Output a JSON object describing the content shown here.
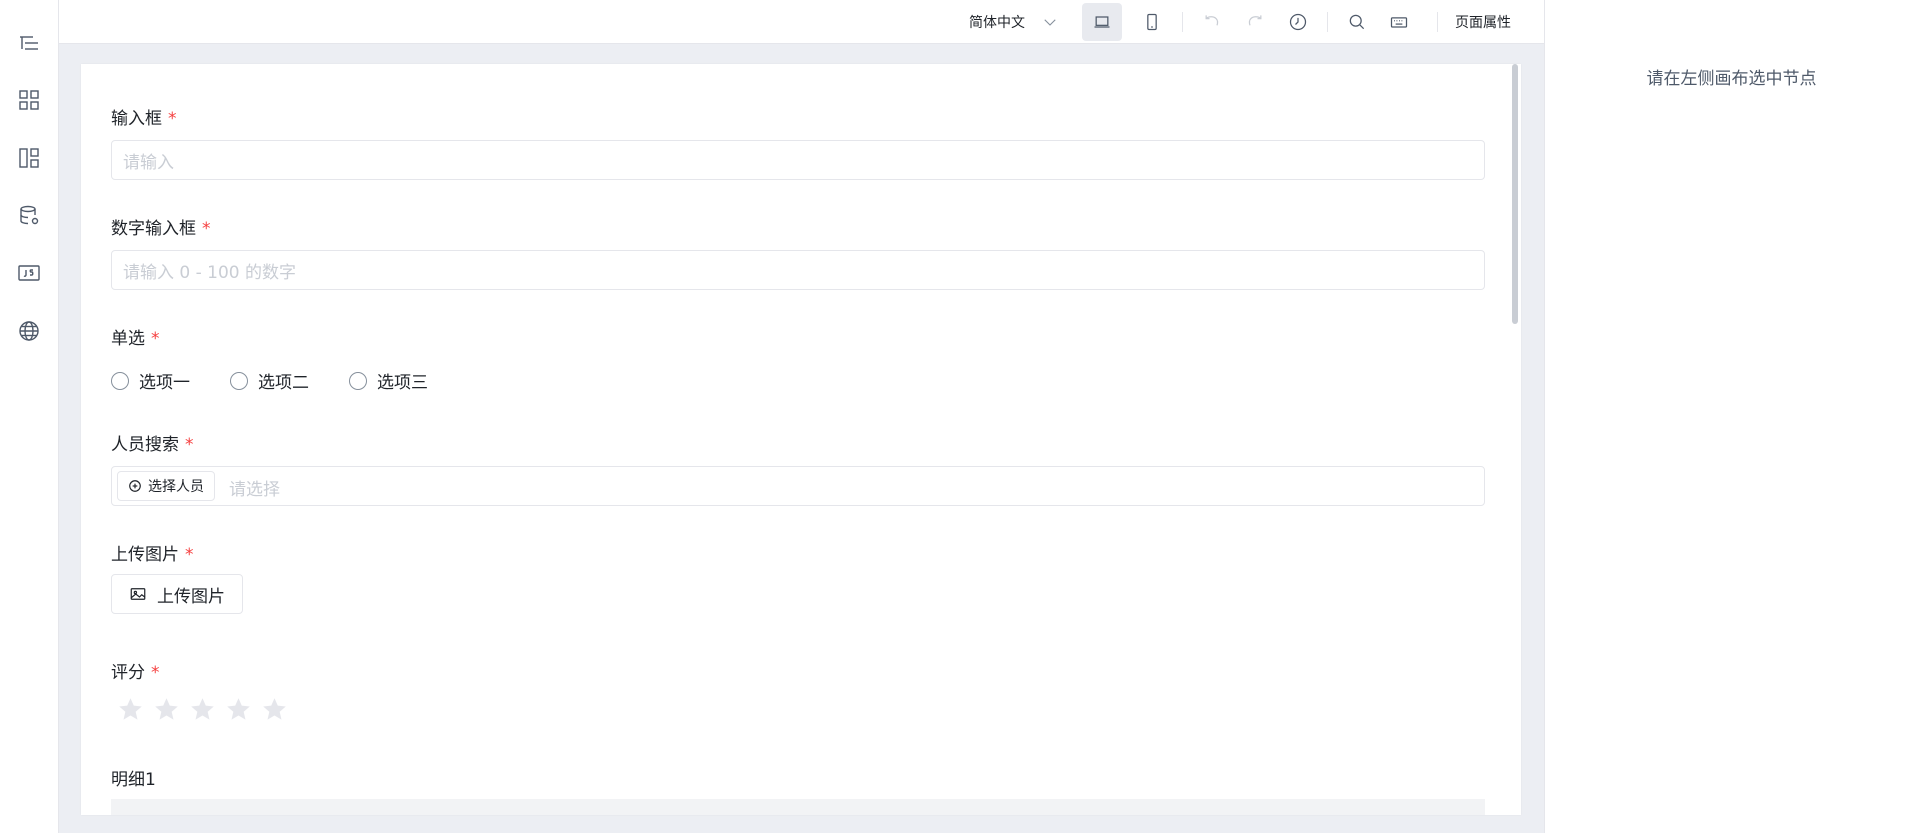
{
  "rail": {
    "icons": [
      "outline-icon",
      "components-icon",
      "layout-icon",
      "datasource-icon",
      "js-icon",
      "globe-icon"
    ]
  },
  "toolbar": {
    "language": "简体中文",
    "page_props": "页面属性"
  },
  "form": {
    "input": {
      "label": "输入框",
      "required": "*",
      "placeholder": "请输入"
    },
    "number": {
      "label": "数字输入框",
      "required": "*",
      "placeholder": "请输入 0 - 100 的数字"
    },
    "radio": {
      "label": "单选",
      "required": "*",
      "options": [
        "选项一",
        "选项二",
        "选项三"
      ]
    },
    "person": {
      "label": "人员搜索",
      "required": "*",
      "button": "选择人员",
      "placeholder": "请选择"
    },
    "upload": {
      "label": "上传图片",
      "required": "*",
      "button": "上传图片"
    },
    "rate": {
      "label": "评分",
      "required": "*",
      "value": 0,
      "max": 5
    },
    "detail": {
      "label": "明细1"
    }
  },
  "right_panel": {
    "hint": "请在左侧画布选中节点"
  },
  "colors": {
    "required": "#f53f3f",
    "canvas_bg": "#eceef3",
    "star_empty": "#e5e6eb"
  }
}
